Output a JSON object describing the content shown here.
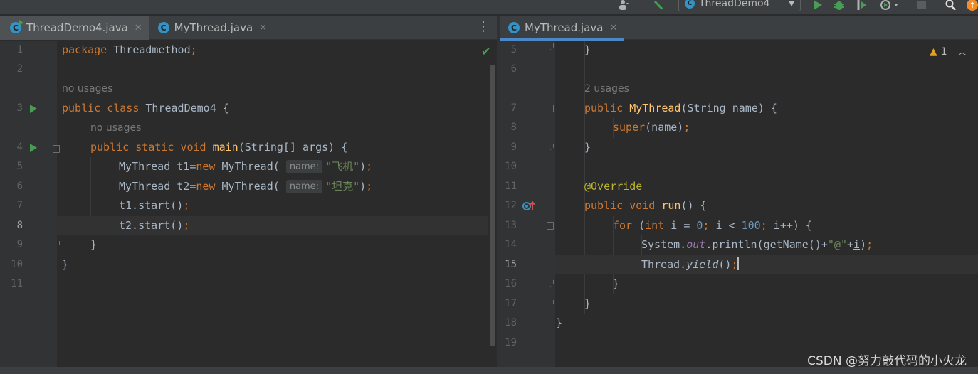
{
  "toolbar": {
    "run_config": "ThreadDemo4",
    "icons": [
      "user-icon",
      "build-hammer-icon",
      "run-icon",
      "debug-icon",
      "coverage-icon",
      "profile-icon",
      "stop-icon",
      "search-icon",
      "update-icon"
    ]
  },
  "left_tabs": [
    {
      "label": "ThreadDemo4.java",
      "active": true
    },
    {
      "label": "MyThread.java",
      "active": false
    }
  ],
  "right_tabs": [
    {
      "label": "MyThread.java",
      "active": true
    }
  ],
  "left_editor": {
    "line_numbers": [
      "1",
      "2",
      "3",
      "4",
      "5",
      "6",
      "7",
      "8",
      "9",
      "10",
      "11"
    ],
    "current_line": "8",
    "usage_hints": {
      "class": "no usages",
      "main": "no usages"
    },
    "inlay_hint_label": "name:",
    "strings": {
      "s1": "\"飞机\"",
      "s2": "\"坦克\""
    }
  },
  "right_editor": {
    "line_numbers": [
      "5",
      "6",
      "7",
      "8",
      "9",
      "10",
      "11",
      "12",
      "13",
      "14",
      "15",
      "16",
      "17",
      "18",
      "19"
    ],
    "current_line": "15",
    "usage_hint": "2 usages",
    "warnings_count": "1",
    "strings": {
      "at": "\"@\""
    },
    "numbers": {
      "zero": "0",
      "hundred": "100"
    }
  },
  "watermark": "CSDN @努力敲代码的小火龙",
  "colors": {
    "keyword": "#cc7832",
    "string": "#6a8759",
    "number": "#6897bb",
    "method": "#ffc66d",
    "annotation": "#bbb529",
    "static_field": "#9876aa",
    "tab_underline": "#4a88c7",
    "run_green": "#499c54",
    "warning": "#e0a020"
  }
}
